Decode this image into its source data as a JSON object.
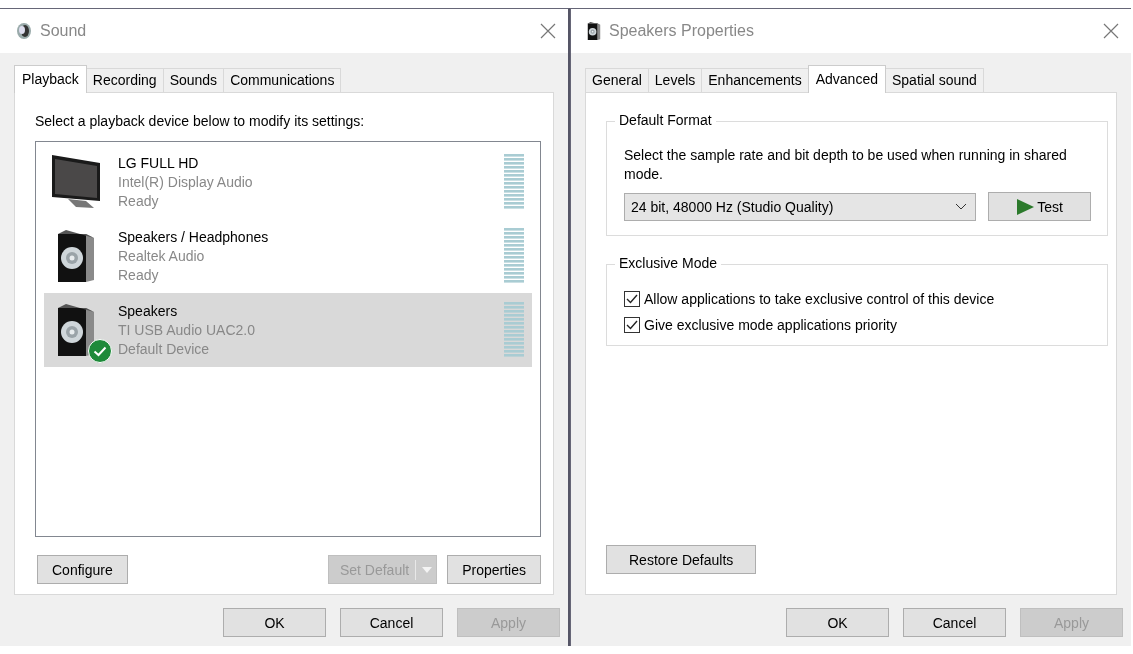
{
  "sound_window": {
    "title": "Sound",
    "tabs": [
      {
        "label": "Playback",
        "selected": true
      },
      {
        "label": "Recording",
        "selected": false
      },
      {
        "label": "Sounds",
        "selected": false
      },
      {
        "label": "Communications",
        "selected": false
      }
    ],
    "instruction": "Select a playback device below to modify its settings:",
    "devices": [
      {
        "kind": "monitor",
        "name": "LG FULL HD",
        "driver": "Intel(R) Display Audio",
        "status": "Ready",
        "default": false,
        "selected": false
      },
      {
        "kind": "speaker",
        "name": "Speakers / Headphones",
        "driver": "Realtek Audio",
        "status": "Ready",
        "default": false,
        "selected": false
      },
      {
        "kind": "speaker",
        "name": "Speakers",
        "driver": "TI USB Audio UAC2.0",
        "status": "Default Device",
        "default": true,
        "selected": true
      }
    ],
    "configure_button": {
      "label": "Configure",
      "disabled": false
    },
    "set_default_button": {
      "label": "Set Default",
      "disabled": true
    },
    "properties_button": {
      "label": "Properties",
      "disabled": false
    },
    "footer_buttons": [
      {
        "label": "OK",
        "disabled": false
      },
      {
        "label": "Cancel",
        "disabled": false
      },
      {
        "label": "Apply",
        "disabled": true
      }
    ]
  },
  "properties_window": {
    "title": "Speakers Properties",
    "tabs": [
      {
        "label": "General",
        "selected": false
      },
      {
        "label": "Levels",
        "selected": false
      },
      {
        "label": "Enhancements",
        "selected": false
      },
      {
        "label": "Advanced",
        "selected": true
      },
      {
        "label": "Spatial sound",
        "selected": false
      }
    ],
    "default_format": {
      "heading": "Default Format",
      "description": "Select the sample rate and bit depth to be used when running in shared mode.",
      "format": "24 bit, 48000 Hz (Studio Quality)",
      "test_button": "Test"
    },
    "exclusive_mode": {
      "heading": "Exclusive Mode",
      "options": [
        {
          "label": "Allow applications to take exclusive control of this device",
          "checked": true
        },
        {
          "label": "Give exclusive mode applications priority",
          "checked": true
        }
      ]
    },
    "restore_button": "Restore Defaults",
    "footer_buttons": [
      {
        "label": "OK",
        "disabled": false
      },
      {
        "label": "Cancel",
        "disabled": false
      },
      {
        "label": "Apply",
        "disabled": true
      }
    ]
  }
}
